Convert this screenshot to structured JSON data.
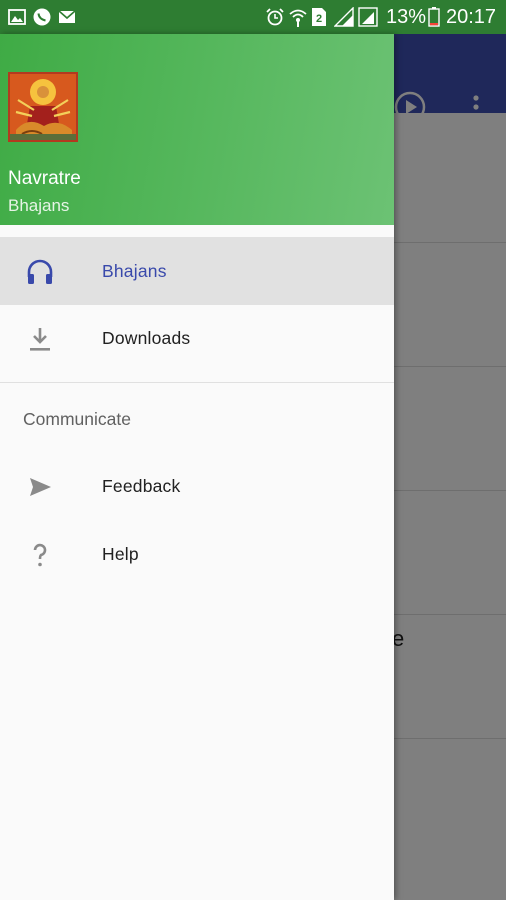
{
  "status_bar": {
    "battery_percent": "13%",
    "time": "20:17",
    "sim_slot": "2",
    "icons": [
      "gallery-icon",
      "whatsapp-icon",
      "mail-icon",
      "alarm-icon",
      "wifi-icon",
      "sim-icon",
      "signal-icon",
      "signal-icon",
      "battery-icon"
    ]
  },
  "background": {
    "partial_text": "e",
    "toolbar_color": "#3f51b5",
    "icons": [
      "play-icon",
      "more-vert-icon"
    ]
  },
  "drawer": {
    "header": {
      "title": "Navratre",
      "subtitle": "Bhajans",
      "image": "goddess-durga-image"
    },
    "menu": [
      {
        "label": "Bhajans",
        "icon": "headphones-icon",
        "selected": true
      },
      {
        "label": "Downloads",
        "icon": "download-icon",
        "selected": false
      }
    ],
    "section": {
      "title": "Communicate",
      "items": [
        {
          "label": "Feedback",
          "icon": "send-icon"
        },
        {
          "label": "Help",
          "icon": "help-icon"
        }
      ]
    }
  },
  "colors": {
    "header_green": "#4caf50",
    "status_bar_green": "#2e7d32",
    "selected_accent": "#3949ab",
    "selected_background": "#e1e1e1"
  }
}
